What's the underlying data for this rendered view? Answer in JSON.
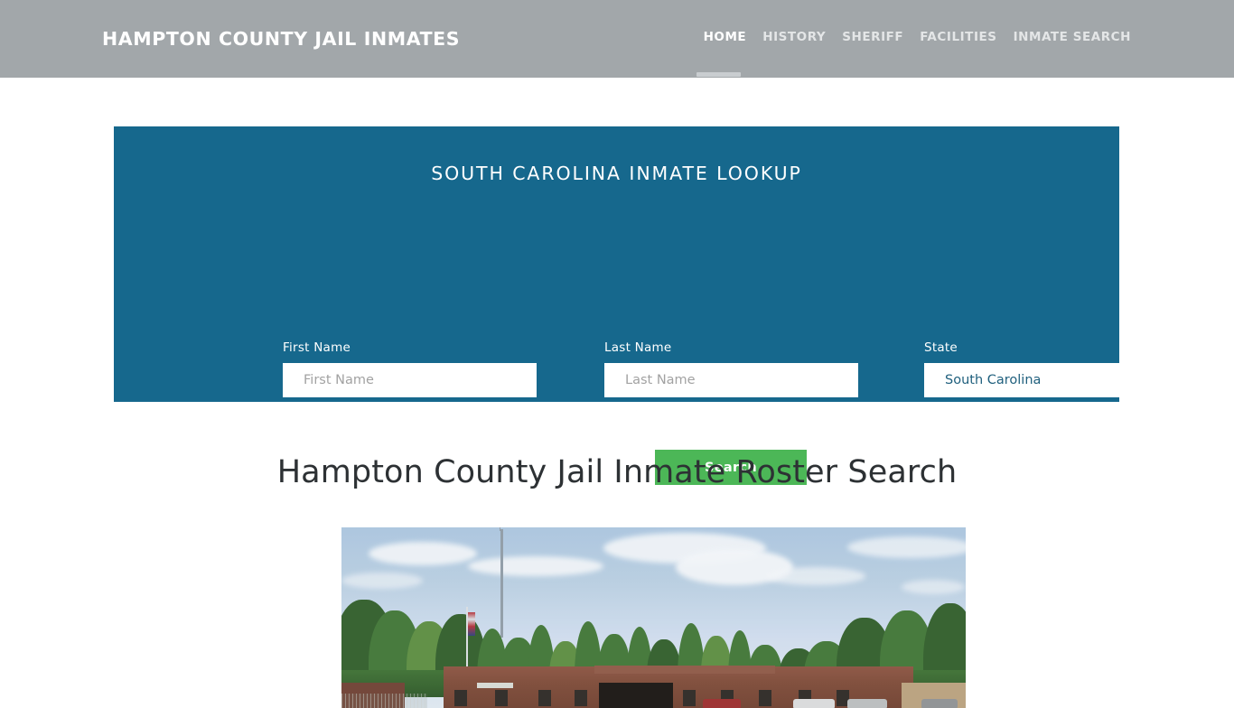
{
  "site": {
    "brand": "HAMPTON COUNTY JAIL INMATES"
  },
  "nav": {
    "items": [
      {
        "label": "HOME",
        "active": true
      },
      {
        "label": "HISTORY",
        "active": false
      },
      {
        "label": "SHERIFF",
        "active": false
      },
      {
        "label": "FACILITIES",
        "active": false
      },
      {
        "label": "INMATE SEARCH",
        "active": false
      }
    ]
  },
  "lookup": {
    "title": "SOUTH CAROLINA INMATE LOOKUP",
    "fields": {
      "first_name": {
        "label": "First Name",
        "placeholder": "First Name",
        "value": ""
      },
      "last_name": {
        "label": "Last Name",
        "placeholder": "Last Name",
        "value": ""
      },
      "state": {
        "label": "State",
        "placeholder": "State",
        "value": "South Carolina"
      }
    },
    "submit_label": "Search"
  },
  "main": {
    "heading": "Hampton County Jail Inmate Roster Search",
    "photo_alt": "Hampton County Detention Center building"
  },
  "colors": {
    "header_bg": "#a2a7aa",
    "panel_bg": "#16688d",
    "button_bg": "#4cb757",
    "heading_text": "#2d3134",
    "nav_active": "#ffffff",
    "nav_inactive": "#e4e6e7"
  }
}
